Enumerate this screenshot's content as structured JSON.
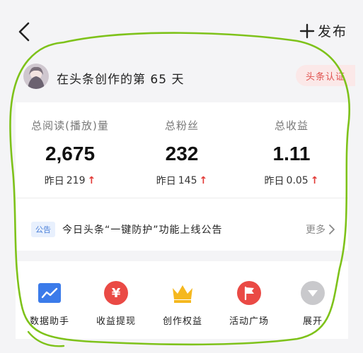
{
  "topbar": {
    "back_icon": "chevron-left-icon",
    "publish_label": "发布",
    "publish_icon": "plus-icon"
  },
  "header": {
    "days_text": "在头条创作的第 65 天",
    "cert_label": "头条认证",
    "accent_color": "#e0524f"
  },
  "stats": {
    "items": [
      {
        "label": "总阅读(播放)量",
        "value": "2,675",
        "yesterday_label": "昨日",
        "yesterday_value": "219"
      },
      {
        "label": "总粉丝",
        "value": "232",
        "yesterday_label": "昨日",
        "yesterday_value": "145"
      },
      {
        "label": "总收益",
        "value": "1.11",
        "yesterday_label": "昨日",
        "yesterday_value": "0.05"
      }
    ],
    "up_color": "#e23a36"
  },
  "notice": {
    "tag": "公告",
    "text": "今日头条“一键防护”功能上线公告",
    "more_label": "更多"
  },
  "tools": {
    "items": [
      {
        "label": "数据助手",
        "icon": "chart-icon",
        "color": "#3b7bea"
      },
      {
        "label": "收益提现",
        "icon": "yen-icon",
        "color": "#ea4a45"
      },
      {
        "label": "创作权益",
        "icon": "crown-icon",
        "color": "#f5b81f"
      },
      {
        "label": "活动广场",
        "icon": "flag-icon",
        "color": "#ea4a45"
      },
      {
        "label": "展开",
        "icon": "expand-icon",
        "color": "#c9c9cc"
      }
    ]
  }
}
